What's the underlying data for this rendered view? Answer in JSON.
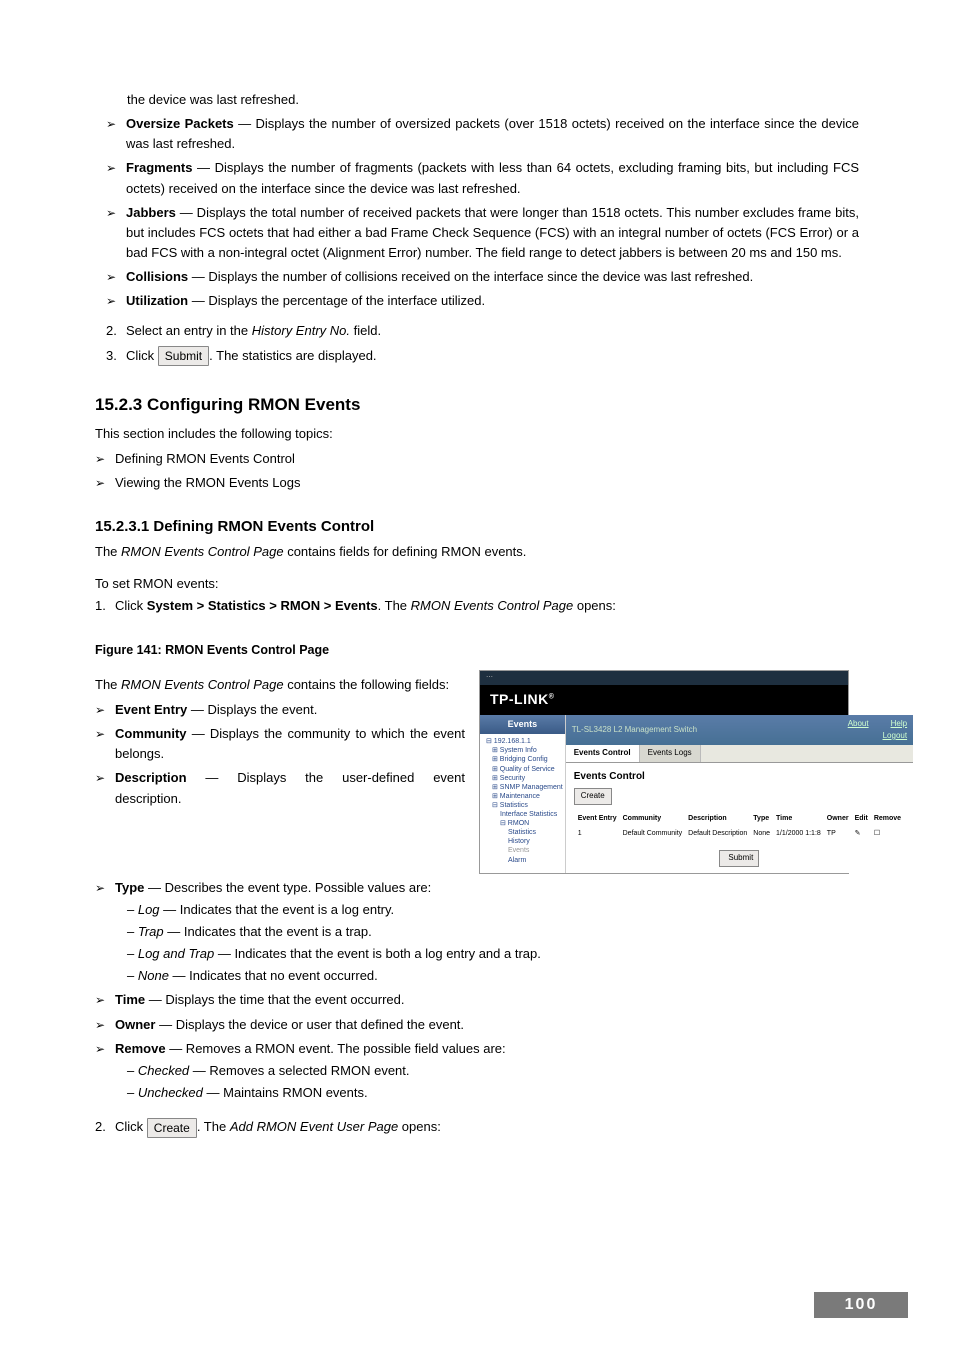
{
  "intro_continued": "the device was last refreshed.",
  "bullets_top": [
    {
      "term": "Oversize Packets",
      "text": " — Displays the number of oversized packets (over 1518 octets) received on the interface since the device was last refreshed."
    },
    {
      "term": "Fragments",
      "text": " — Displays the number of fragments (packets with less than 64 octets, excluding framing bits, but including FCS octets) received on the interface since the device was last refreshed."
    },
    {
      "term": "Jabbers",
      "text": " — Displays the total number of received packets that were longer than 1518 octets. This number excludes frame bits, but includes FCS octets that had either a bad Frame Check Sequence (FCS) with an integral number of octets (FCS Error) or a bad FCS with a non-integral octet (Alignment Error) number. The field range to detect jabbers is between 20 ms and 150 ms."
    },
    {
      "term": "Collisions",
      "text": " — Displays the number of collisions received on the interface since the device was last refreshed."
    },
    {
      "term": "Utilization",
      "text": " — Displays the percentage of the interface utilized."
    }
  ],
  "step2": {
    "num": "2.",
    "pre": "Select an entry in the ",
    "it": "History Entry No.",
    "post": " field."
  },
  "step3": {
    "num": "3.",
    "pre": "Click ",
    "btn": "Submit",
    "post": ". The statistics are displayed."
  },
  "sec1523": {
    "heading": "15.2.3   Configuring RMON Events",
    "intro": "This section includes the following topics:",
    "items": [
      "Defining RMON Events Control",
      "Viewing the RMON Events Logs"
    ]
  },
  "sec15231": {
    "heading": "15.2.3.1  Defining RMON Events Control",
    "p1_pre": "The ",
    "p1_it": "RMON Events Control Page",
    "p1_post": " contains fields for defining RMON events.",
    "p2": "To set RMON events:",
    "s1": {
      "num": "1.",
      "pre": "Click ",
      "path": "System > Statistics > RMON > Events",
      "mid": ". The ",
      "it": "RMON Events Control Page",
      "post": " opens:"
    }
  },
  "fig": "Figure 141: RMON Events Control Page",
  "leftcol": {
    "intro_pre": "The ",
    "intro_it": "RMON Events Control Page",
    "intro_post": " contains the following fields:",
    "bullets": [
      {
        "term": "Event Entry",
        "text": " — Displays the event."
      },
      {
        "term": "Community",
        "text": " — Displays the community to which the event belongs."
      },
      {
        "term": "Description",
        "text": " — Displays the user-defined event description."
      }
    ]
  },
  "type_bullet": {
    "term": "Type",
    "text": " — Describes the event type. Possible values are:"
  },
  "type_sub": [
    {
      "it": "Log",
      "text": " — Indicates that the event is a log entry."
    },
    {
      "it": "Trap",
      "text": " — Indicates that the event is a trap."
    },
    {
      "it": "Log and Trap",
      "text": " — Indicates that the event is both a log entry and a trap."
    },
    {
      "it": "None",
      "text": " — Indicates that no event occurred."
    }
  ],
  "lower_bullets": [
    {
      "term": "Time",
      "text": " — Displays the time that the event occurred."
    },
    {
      "term": "Owner",
      "text": " — Displays the device or user that defined the event."
    },
    {
      "term": "Remove",
      "text": " — Removes a RMON event. The possible field values are:"
    }
  ],
  "remove_sub": [
    {
      "it": "Checked",
      "text": " — Removes a selected RMON event."
    },
    {
      "it": "Unchecked",
      "text": " — Maintains RMON events."
    }
  ],
  "step_create": {
    "num": "2.",
    "pre": "Click ",
    "btn": "Create",
    "mid": ". The ",
    "it": "Add RMON Event User Page",
    "post": " opens:"
  },
  "scr": {
    "brand": "TP-LINK",
    "side_head": "Events",
    "titlebar_left": "TL-SL3428 L2 Management Switch",
    "titlebar_about": "About",
    "titlebar_help": "Help",
    "titlebar_logout": "Logout",
    "tab1": "Events Control",
    "tab2": "Events Logs",
    "body_h": "Events Control",
    "create": "Create",
    "cols": [
      "Event Entry",
      "Community",
      "Description",
      "Type",
      "Time",
      "Owner",
      "Edit",
      "Remove"
    ],
    "row": [
      "1",
      "Default Community",
      "Default Description",
      "None",
      "1/1/2000 1:1:8",
      "TP",
      "✎",
      "☐"
    ],
    "submit": "Submit",
    "tree": [
      {
        "cls": "tr0",
        "t": "⊟ 192.168.1.1"
      },
      {
        "cls": "tr1",
        "t": "⊞ System Info"
      },
      {
        "cls": "tr1",
        "t": "⊞ Bridging Config"
      },
      {
        "cls": "tr1",
        "t": "⊞ Quality of Service"
      },
      {
        "cls": "tr1",
        "t": "⊞ Security"
      },
      {
        "cls": "tr1",
        "t": "⊞ SNMP Management"
      },
      {
        "cls": "tr1",
        "t": "⊞ Maintenance"
      },
      {
        "cls": "tr1",
        "t": "⊟ Statistics"
      },
      {
        "cls": "tr2",
        "t": "Interface Statistics"
      },
      {
        "cls": "tr2",
        "t": "⊟ RMON"
      },
      {
        "cls": "tr3",
        "t": "Statistics"
      },
      {
        "cls": "tr3",
        "t": "History"
      },
      {
        "cls": "tr3 tr-sel",
        "t": "Events"
      },
      {
        "cls": "tr3",
        "t": "Alarm"
      }
    ]
  },
  "page_number": "100"
}
